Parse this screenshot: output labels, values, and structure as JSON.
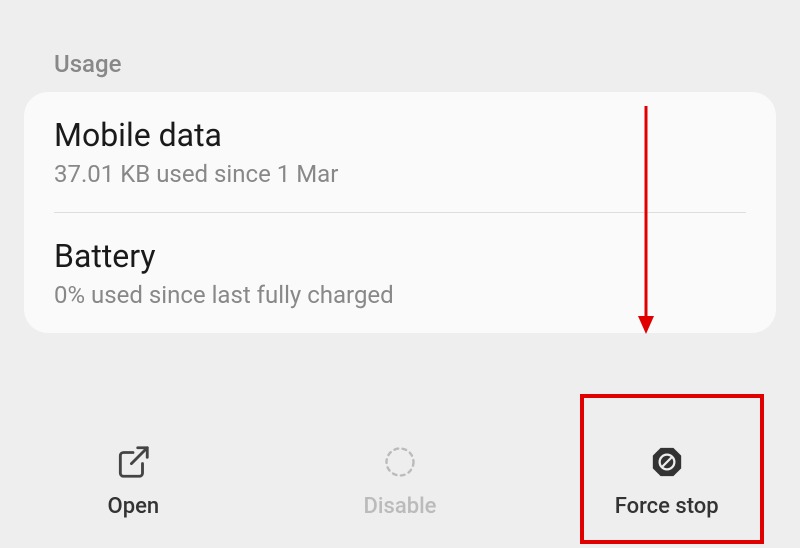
{
  "section": {
    "header": "Usage",
    "items": [
      {
        "title": "Mobile data",
        "subtitle": "37.01 KB used since 1 Mar"
      },
      {
        "title": "Battery",
        "subtitle": "0% used since last fully charged"
      }
    ]
  },
  "bottomBar": {
    "open": "Open",
    "disable": "Disable",
    "forceStop": "Force stop"
  },
  "annotation": {
    "arrowColor": "#e00000",
    "highlightColor": "#e00000"
  }
}
